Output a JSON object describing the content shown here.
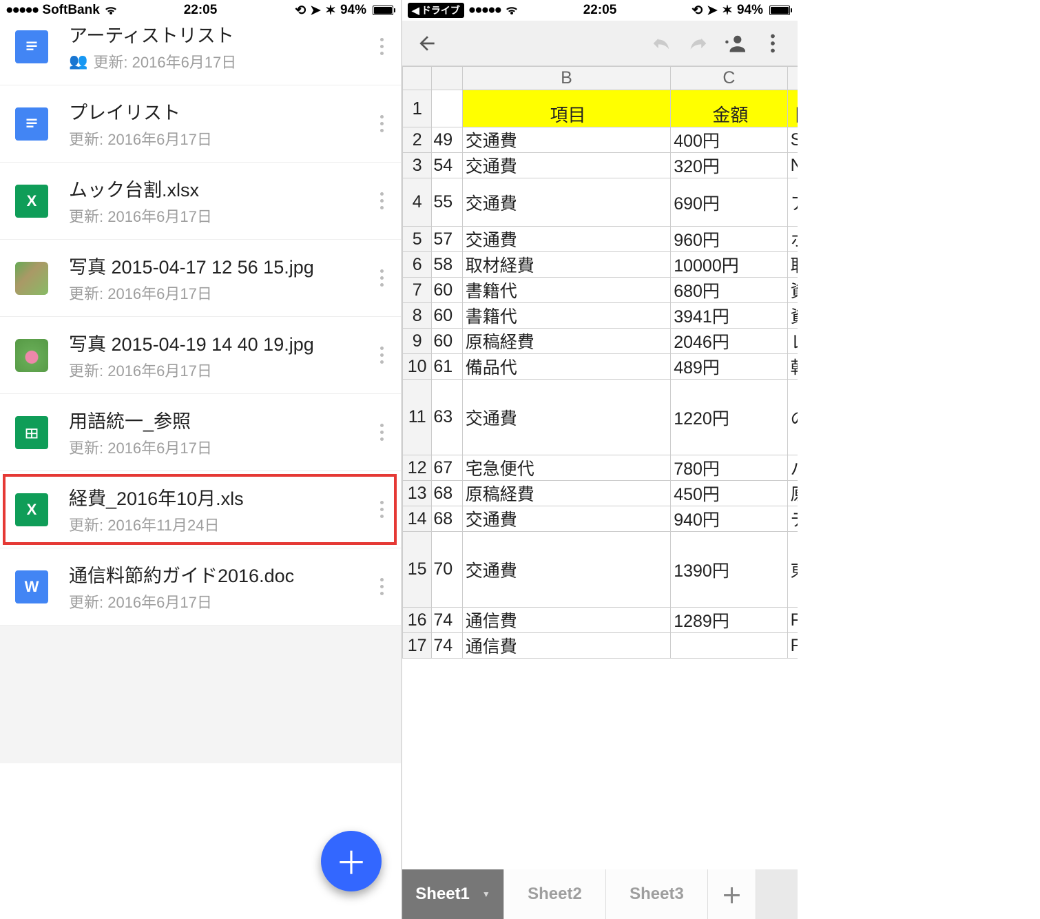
{
  "status": {
    "left": {
      "carrier": "SoftBank",
      "back_app": "ドライブ"
    },
    "time": "22:05",
    "battery_pct": "94%"
  },
  "files": [
    {
      "type": "doc",
      "title": "アーティストリスト",
      "sub": "更新: 2016年6月17日",
      "shared": true,
      "cutoff": true
    },
    {
      "type": "doc",
      "title": "プレイリスト",
      "sub": "更新: 2016年6月17日"
    },
    {
      "type": "xls",
      "title": "ムック台割.xlsx",
      "sub": "更新: 2016年6月17日"
    },
    {
      "type": "photo1",
      "title": "写真 2015-04-17 12 56 15.jpg",
      "sub": "更新: 2016年6月17日"
    },
    {
      "type": "photo2",
      "title": "写真 2015-04-19 14 40 19.jpg",
      "sub": "更新: 2016年6月17日"
    },
    {
      "type": "sheet",
      "title": "用語統一_参照",
      "sub": "更新: 2016年6月17日"
    },
    {
      "type": "xls",
      "title": "経費_2016年10月.xls",
      "sub": "更新: 2016年11月24日",
      "highlight": true
    },
    {
      "type": "word",
      "title": "通信料節約ガイド2016.doc",
      "sub": "更新: 2016年6月17日"
    }
  ],
  "sheet": {
    "col_headers": {
      "b": "B",
      "c": "C"
    },
    "header_row": {
      "b": "項目",
      "c": "金額",
      "d": "日"
    },
    "rows": [
      {
        "n": "2",
        "a": "49",
        "b": "交通費",
        "c": "400円",
        "d": "SI",
        "h": "h-34"
      },
      {
        "n": "3",
        "a": "54",
        "b": "交通費",
        "c": "320円",
        "d": "NI",
        "h": "h-34"
      },
      {
        "n": "4",
        "a": "55",
        "b": "交通費",
        "c": "690円",
        "d": "ア",
        "h": "h-70"
      },
      {
        "n": "5",
        "a": "57",
        "b": "交通費",
        "c": "960円",
        "d": "ホ",
        "h": "h-34"
      },
      {
        "n": "6",
        "a": "58",
        "b": "取材経費",
        "c": "10000円",
        "d": "取",
        "h": "h-34"
      },
      {
        "n": "7",
        "a": "60",
        "b": "書籍代",
        "c": "680円",
        "d": "資",
        "h": "h-34"
      },
      {
        "n": "8",
        "a": "60",
        "b": "書籍代",
        "c": "3941円",
        "d": "資",
        "h": "h-34"
      },
      {
        "n": "9",
        "a": "60",
        "b": "原稿経費",
        "c": "2046円",
        "d": "レ",
        "h": "h-34"
      },
      {
        "n": "10",
        "a": "61",
        "b": "備品代",
        "c": "489円",
        "d": "乾",
        "h": "h-34"
      },
      {
        "n": "11",
        "a": "63",
        "b": "交通費",
        "c": "1220円",
        "d": "の",
        "h": "h-110"
      },
      {
        "n": "12",
        "a": "67",
        "b": "宅急便代",
        "c": "780円",
        "d": "バ",
        "h": "h-34"
      },
      {
        "n": "13",
        "a": "68",
        "b": "原稿経費",
        "c": "450円",
        "d": "原",
        "h": "h-34"
      },
      {
        "n": "14",
        "a": "68",
        "b": "交通費",
        "c": "940円",
        "d": "デ",
        "h": "h-34"
      },
      {
        "n": "15",
        "a": "70",
        "b": "交通費",
        "c": "1390円",
        "d": "東",
        "h": "h-110"
      },
      {
        "n": "16",
        "a": "74",
        "b": "通信費",
        "c": "1289円",
        "d": "FF",
        "h": "h-34"
      },
      {
        "n": "17",
        "a": "74",
        "b": "通信費",
        "c": "",
        "d": "FF",
        "h": "h-34"
      }
    ],
    "tabs": [
      "Sheet1",
      "Sheet2",
      "Sheet3"
    ]
  }
}
